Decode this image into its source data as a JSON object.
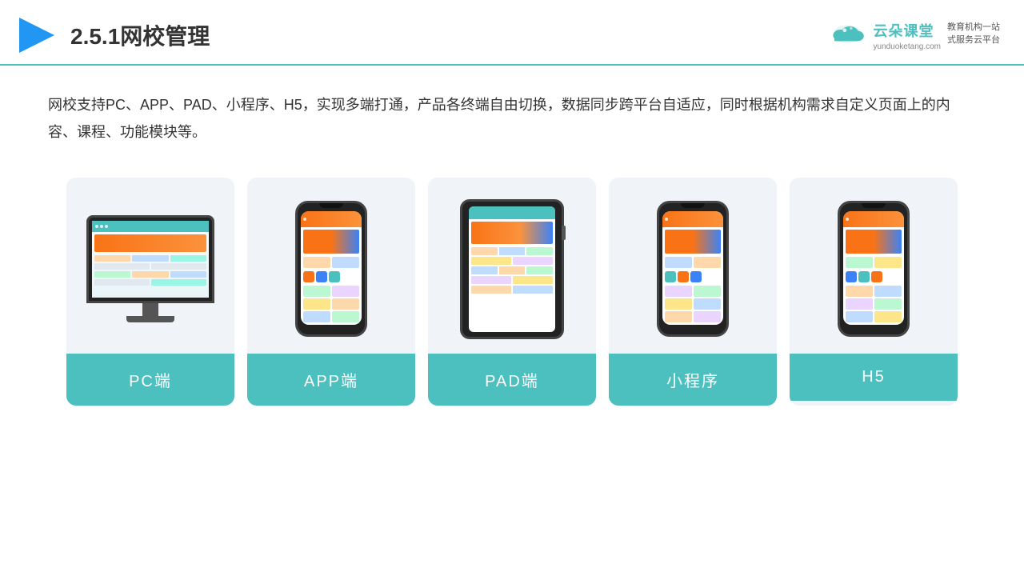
{
  "header": {
    "title": "2.5.1网校管理",
    "logo_name": "云朵课堂",
    "logo_url": "yunduoketang.com",
    "logo_tagline": "教育机构一站\n式服务云平台"
  },
  "description": {
    "text": "网校支持PC、APP、PAD、小程序、H5，实现多端打通，产品各终端自由切换，数据同步跨平台自适应，同时根据机构需求自定义页面上的内容、课程、功能模块等。"
  },
  "cards": [
    {
      "label": "PC端",
      "id": "pc"
    },
    {
      "label": "APP端",
      "id": "app"
    },
    {
      "label": "PAD端",
      "id": "pad"
    },
    {
      "label": "小程序",
      "id": "miniprogram"
    },
    {
      "label": "H5",
      "id": "h5"
    }
  ],
  "colors": {
    "accent": "#4CBFBF",
    "border": "#4CBFBF"
  }
}
